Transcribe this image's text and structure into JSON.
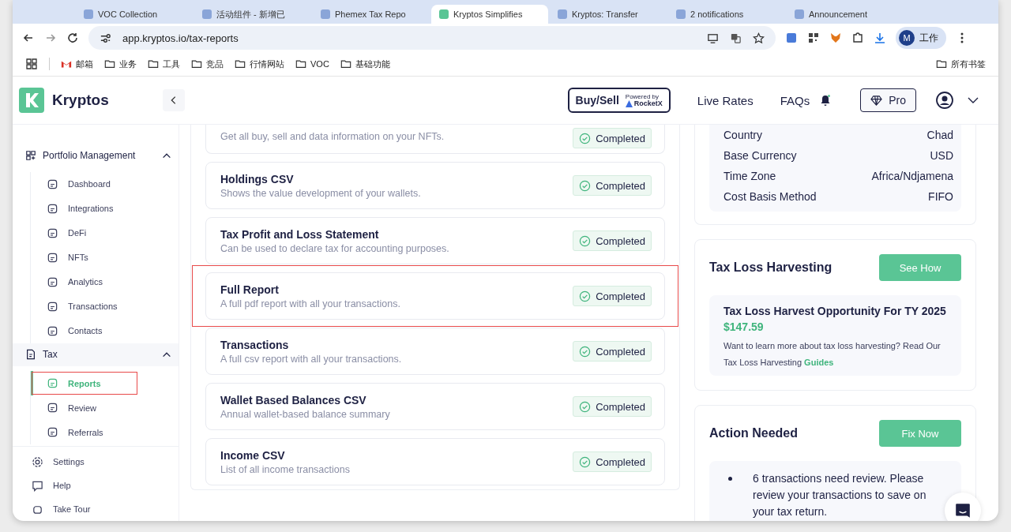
{
  "browser": {
    "tabs": [
      {
        "title": "VOC Collection",
        "selected": false
      },
      {
        "title": "活动组件 - 新增已",
        "selected": false
      },
      {
        "title": "Phemex Tax Repo",
        "selected": false
      },
      {
        "title": "Kryptos Simplifies",
        "selected": true
      },
      {
        "title": "Kryptos: Transfer",
        "selected": false
      },
      {
        "title": "2 notifications",
        "selected": false
      },
      {
        "title": "Announcement",
        "selected": false
      }
    ],
    "address": "app.kryptos.io/tax-reports",
    "profile": {
      "initial": "M",
      "label": "工作"
    },
    "bookmarks": [
      {
        "label": "邮箱",
        "kind": "mail"
      },
      {
        "label": "业务",
        "kind": "folder"
      },
      {
        "label": "工具",
        "kind": "folder"
      },
      {
        "label": "竞品",
        "kind": "folder"
      },
      {
        "label": "行情网站",
        "kind": "folder"
      },
      {
        "label": "VOC",
        "kind": "folder"
      },
      {
        "label": "基础功能",
        "kind": "folder"
      }
    ],
    "all_bookmarks": "所有书签"
  },
  "header": {
    "brand": "Kryptos",
    "buy_sell": "Buy/Sell",
    "powered_by": "Powered by",
    "partner": "RocketX",
    "links": [
      "Live Rates",
      "FAQs"
    ],
    "pro": "Pro"
  },
  "sidebar": {
    "sections": [
      {
        "label": "Portfolio Management",
        "expanded": true,
        "children": [
          {
            "label": "Dashboard",
            "selected": false,
            "highlighted": false
          },
          {
            "label": "Integrations",
            "selected": false,
            "highlighted": false
          },
          {
            "label": "DeFi",
            "selected": false,
            "highlighted": false
          },
          {
            "label": "NFTs",
            "selected": false,
            "highlighted": false
          },
          {
            "label": "Analytics",
            "selected": false,
            "highlighted": false
          },
          {
            "label": "Transactions",
            "selected": false,
            "highlighted": false
          },
          {
            "label": "Contacts",
            "selected": false,
            "highlighted": false
          }
        ]
      },
      {
        "label": "Tax",
        "expanded": true,
        "children": [
          {
            "label": "Reports",
            "selected": true,
            "highlighted": true
          },
          {
            "label": "Review",
            "selected": false,
            "highlighted": false
          },
          {
            "label": "Referrals",
            "selected": false,
            "highlighted": false
          }
        ]
      }
    ],
    "footer": [
      "Settings",
      "Help",
      "Take Tour"
    ]
  },
  "reports": [
    {
      "description": "Get all buy, sell and data information on your NFTs.",
      "status": "Completed",
      "highlighted": false
    },
    {
      "title": "Holdings CSV",
      "description": "Shows the value development of your wallets.",
      "status": "Completed",
      "highlighted": false
    },
    {
      "title": "Tax Profit and Loss Statement",
      "description": "Can be used to declare tax for accounting purposes.",
      "status": "Completed",
      "highlighted": false
    },
    {
      "title": "Full Report",
      "description": "A full pdf report with all your transactions.",
      "status": "Completed",
      "highlighted": true
    },
    {
      "title": "Transactions",
      "description": "A full csv report with all your transactions.",
      "status": "Completed",
      "highlighted": false
    },
    {
      "title": "Wallet Based Balances CSV",
      "description": "Annual wallet-based balance summary",
      "status": "Completed",
      "highlighted": false
    },
    {
      "title": "Income CSV",
      "description": "List of all income transactions",
      "status": "Completed",
      "highlighted": false
    }
  ],
  "settings": [
    {
      "label": "Country",
      "value": "Chad"
    },
    {
      "label": "Base Currency",
      "value": "USD"
    },
    {
      "label": "Time Zone",
      "value": "Africa/Ndjamena"
    },
    {
      "label": "Cost Basis Method",
      "value": "FIFO"
    }
  ],
  "harvesting": {
    "title": "Tax Loss Harvesting",
    "button": "See How",
    "heading": "Tax Loss Harvest Opportunity For TY 2025",
    "amount": "$147.59",
    "text": "Want to learn more about tax loss harvesting? Read Our Tax Loss Harvesting",
    "link": "Guides"
  },
  "action": {
    "title": "Action Needed",
    "button": "Fix Now",
    "items": [
      "6 transactions need review. Please review your transactions to save on your tax return."
    ]
  }
}
